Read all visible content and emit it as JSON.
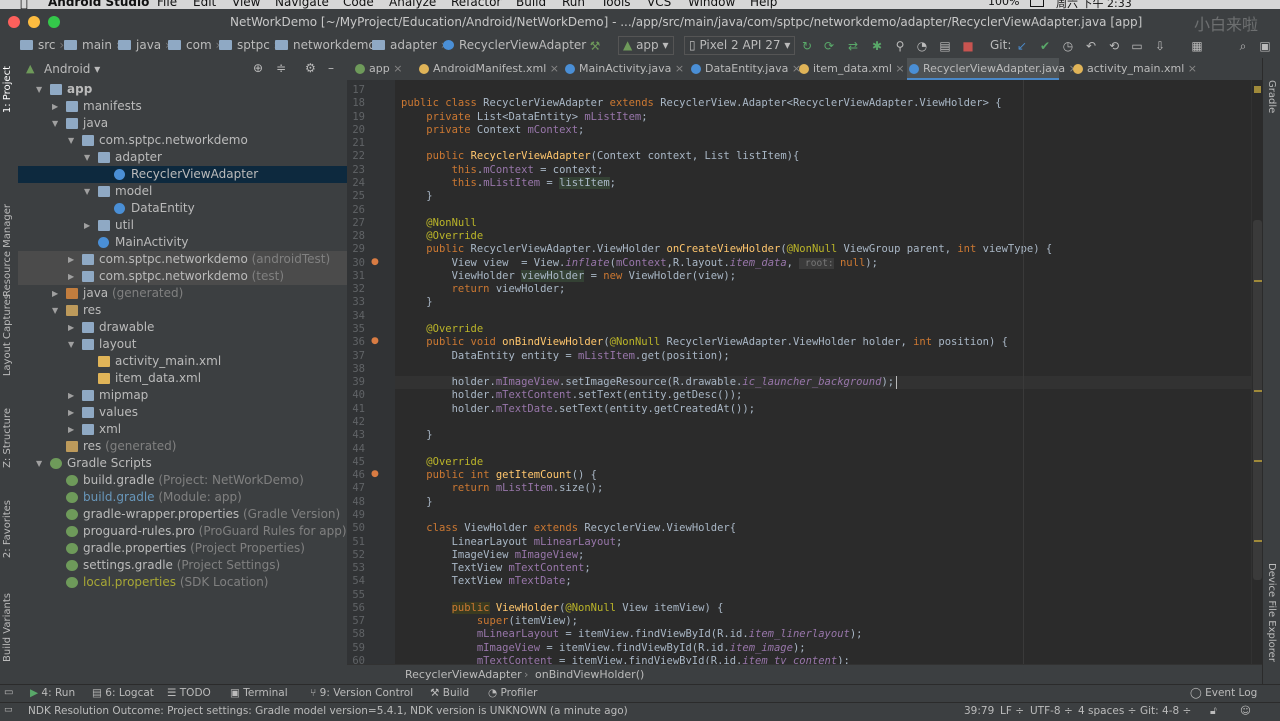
{
  "menubar": {
    "app_name": "Android Studio",
    "items": [
      "File",
      "Edit",
      "View",
      "Navigate",
      "Code",
      "Analyze",
      "Refactor",
      "Build",
      "Run",
      "Tools",
      "VCS",
      "Window",
      "Help"
    ],
    "battery": "100%",
    "clock": "周六 下午 2:33"
  },
  "window": {
    "title": "NetWorkDemo [~/MyProject/Education/Android/NetWorkDemo] - .../app/src/main/java/com/sptpc/networkdemo/adapter/RecyclerViewAdapter.java [app]",
    "watermark": "小白来啦"
  },
  "navbar": {
    "crumbs": [
      "src",
      "main",
      "java",
      "com",
      "sptpc",
      "networkdemo",
      "adapter",
      "RecyclerViewAdapter"
    ],
    "run_config": "app",
    "device": "Pixel 2 API 27",
    "git_label": "Git:"
  },
  "left_tabs": [
    "1: Project",
    "Resource Manager",
    "Layout Captures",
    "Z: Structure",
    "2: Favorites",
    "Build Variants"
  ],
  "right_tabs": [
    "Gradle",
    "Device File Explorer"
  ],
  "project_panel": {
    "view_mode": "Android",
    "tree": [
      {
        "label": "app",
        "hint": "",
        "depth": 0,
        "arrow": "down",
        "icon": "folder",
        "style": "bold"
      },
      {
        "label": "manifests",
        "hint": "",
        "depth": 1,
        "arrow": "right",
        "icon": "folder"
      },
      {
        "label": "java",
        "hint": "",
        "depth": 1,
        "arrow": "down",
        "icon": "folder"
      },
      {
        "label": "com.sptpc.networkdemo",
        "hint": "",
        "depth": 2,
        "arrow": "down",
        "icon": "pkg"
      },
      {
        "label": "adapter",
        "hint": "",
        "depth": 3,
        "arrow": "down",
        "icon": "pkg"
      },
      {
        "label": "RecyclerViewAdapter",
        "hint": "",
        "depth": 4,
        "arrow": "",
        "icon": "class",
        "selected": true
      },
      {
        "label": "model",
        "hint": "",
        "depth": 3,
        "arrow": "down",
        "icon": "pkg"
      },
      {
        "label": "DataEntity",
        "hint": "",
        "depth": 4,
        "arrow": "",
        "icon": "class"
      },
      {
        "label": "util",
        "hint": "",
        "depth": 3,
        "arrow": "right",
        "icon": "pkg"
      },
      {
        "label": "MainActivity",
        "hint": "",
        "depth": 3,
        "arrow": "",
        "icon": "class"
      },
      {
        "label": "com.sptpc.networkdemo",
        "hint": " (androidTest)",
        "depth": 2,
        "arrow": "right",
        "icon": "pkg",
        "shaded": true
      },
      {
        "label": "com.sptpc.networkdemo",
        "hint": " (test)",
        "depth": 2,
        "arrow": "right",
        "icon": "pkg",
        "shaded": true
      },
      {
        "label": "java",
        "hint": " (generated)",
        "depth": 1,
        "arrow": "right",
        "icon": "java"
      },
      {
        "label": "res",
        "hint": "",
        "depth": 1,
        "arrow": "down",
        "icon": "res"
      },
      {
        "label": "drawable",
        "hint": "",
        "depth": 2,
        "arrow": "right",
        "icon": "folder"
      },
      {
        "label": "layout",
        "hint": "",
        "depth": 2,
        "arrow": "down",
        "icon": "folder"
      },
      {
        "label": "activity_main.xml",
        "hint": "",
        "depth": 3,
        "arrow": "",
        "icon": "xml"
      },
      {
        "label": "item_data.xml",
        "hint": "",
        "depth": 3,
        "arrow": "",
        "icon": "xml"
      },
      {
        "label": "mipmap",
        "hint": "",
        "depth": 2,
        "arrow": "right",
        "icon": "folder"
      },
      {
        "label": "values",
        "hint": "",
        "depth": 2,
        "arrow": "right",
        "icon": "folder"
      },
      {
        "label": "xml",
        "hint": "",
        "depth": 2,
        "arrow": "right",
        "icon": "folder"
      },
      {
        "label": "res",
        "hint": " (generated)",
        "depth": 1,
        "arrow": "",
        "icon": "res"
      },
      {
        "label": "Gradle Scripts",
        "hint": "",
        "depth": 0,
        "arrow": "down",
        "icon": "gradle"
      },
      {
        "label": "build.gradle",
        "hint": " (Project: NetWorkDemo)",
        "depth": 1,
        "arrow": "",
        "icon": "gradle"
      },
      {
        "label": "build.gradle",
        "hint": " (Module: app)",
        "depth": 1,
        "arrow": "",
        "icon": "gradle",
        "color": "#6897bb"
      },
      {
        "label": "gradle-wrapper.properties",
        "hint": " (Gradle Version)",
        "depth": 1,
        "arrow": "",
        "icon": "gradle"
      },
      {
        "label": "proguard-rules.pro",
        "hint": " (ProGuard Rules for app)",
        "depth": 1,
        "arrow": "",
        "icon": "gradle"
      },
      {
        "label": "gradle.properties",
        "hint": " (Project Properties)",
        "depth": 1,
        "arrow": "",
        "icon": "gradle"
      },
      {
        "label": "settings.gradle",
        "hint": " (Project Settings)",
        "depth": 1,
        "arrow": "",
        "icon": "gradle"
      },
      {
        "label": "local.properties",
        "hint": " (SDK Location)",
        "depth": 1,
        "arrow": "",
        "icon": "gradle",
        "color": "#a8a836"
      }
    ]
  },
  "editor_tabs": [
    {
      "label": "app",
      "icon_color": "#6e9a5a"
    },
    {
      "label": "AndroidManifest.xml",
      "icon_color": "#e0b458"
    },
    {
      "label": "MainActivity.java",
      "icon_color": "#4a8fd6"
    },
    {
      "label": "DataEntity.java",
      "icon_color": "#4a8fd6"
    },
    {
      "label": "item_data.xml",
      "icon_color": "#e0b458"
    },
    {
      "label": "RecyclerViewAdapter.java",
      "icon_color": "#4a8fd6",
      "active": true
    },
    {
      "label": "activity_main.xml",
      "icon_color": "#e0b458"
    }
  ],
  "line_numbers": [
    17,
    18,
    19,
    20,
    21,
    22,
    23,
    24,
    25,
    26,
    27,
    28,
    29,
    30,
    31,
    32,
    33,
    34,
    35,
    36,
    37,
    38,
    39,
    40,
    41,
    42,
    43,
    44,
    45,
    46,
    47,
    48,
    49,
    50,
    51,
    52,
    53,
    54,
    55,
    56,
    57,
    58,
    59,
    60
  ],
  "code_lines": [
    "",
    "<span class=\"kw\">public class</span> RecyclerViewAdapter <span class=\"kw\">extends</span> RecyclerView.Adapter&lt;RecyclerViewAdapter.ViewHolder&gt; {",
    "    <span class=\"kw\">private</span> List&lt;DataEntity&gt; <span class=\"fld\">mListItem</span>;",
    "    <span class=\"kw\">private</span> Context <span class=\"fld\">mContext</span>;",
    "",
    "    <span class=\"kw\">public</span> <span class=\"fn\">RecyclerViewAdapter</span>(Context context, List listItem){",
    "        <span class=\"kw\">this</span>.<span class=\"fld\">mContext</span> = context;",
    "        <span class=\"kw\">this</span>.<span class=\"fld\">mListItem</span> = <span class=\"hl\">listItem</span>;",
    "    }",
    "",
    "    <span class=\"ann\">@NonNull</span>",
    "    <span class=\"ann\">@Override</span>",
    "    <span class=\"kw\">public</span> RecyclerViewAdapter.ViewHolder <span class=\"fn\">onCreateViewHolder</span>(<span class=\"ann\">@NonNull</span> ViewGroup parent, <span class=\"kw\">int</span> viewType) {",
    "        View view  = View.<span class=\"it\">inflate</span>(<span class=\"fld\">mContext</span>,R.layout.<span class=\"it\">item_data</span>, <span class=\"hint2\"> root:</span> <span class=\"kw\">null</span>);",
    "        ViewHolder <span class=\"hl\">viewHolder</span> = <span class=\"kw\">new</span> ViewHolder(view);",
    "        <span class=\"kw\">return</span> viewHolder;",
    "    }",
    "",
    "    <span class=\"ann\">@Override</span>",
    "    <span class=\"kw\">public void</span> <span class=\"fn\">onBindViewHolder</span>(<span class=\"ann\">@NonNull</span> RecyclerViewAdapter.ViewHolder holder, <span class=\"kw\">int</span> position) {",
    "        DataEntity entity = <span class=\"fld\">mListItem</span>.get(position);",
    "",
    "        holder.<span class=\"fld\">mImageView</span>.setImageResource(R.drawable.<span class=\"it\">ic_launcher_background</span>);",
    "        holder.<span class=\"fld\">mTextContent</span>.setText(entity.getDesc());",
    "        holder.<span class=\"fld\">mTextDate</span>.setText(entity.getCreatedAt());",
    "",
    "    }",
    "",
    "    <span class=\"ann\">@Override</span>",
    "    <span class=\"kw\">public int</span> <span class=\"fn\">getItemCount</span>() {",
    "        <span class=\"kw\">return</span> <span class=\"fld\">mListItem</span>.size();",
    "    }",
    "",
    "    <span class=\"kw\">class</span> ViewHolder <span class=\"kw\">extends</span> RecyclerView.ViewHolder{",
    "        LinearLayout <span class=\"fld\">mLinearLayout</span>;",
    "        ImageView <span class=\"fld\">mImageView</span>;",
    "        TextView <span class=\"fld\">mTextContent</span>;",
    "        TextView <span class=\"fld\">mTextDate</span>;",
    "",
    "        <span class=\"kw\" style=\"background:#3b3b20\">public</span> <span class=\"fn\">ViewHolder</span>(<span class=\"ann\">@NonNull</span> View itemView) {",
    "            <span class=\"kw\">super</span>(itemView);",
    "            <span class=\"fld\">mLinearLayout</span> = itemView.findViewById(R.id.<span class=\"it\">item_linerlayout</span>);",
    "            <span class=\"fld\">mImageView</span> = itemView.findViewById(R.id.<span class=\"it\">item_image</span>);",
    "            <span class=\"fld\">mTextContent</span> = itemView.findViewById(R.id.<span class=\"it\">item_tv_content</span>);"
  ],
  "editor_breadcrumb": [
    "RecyclerViewAdapter",
    "onBindViewHolder()"
  ],
  "bottom_tools": [
    "4: Run",
    "6: Logcat",
    "TODO",
    "Terminal",
    "9: Version Control",
    "Build",
    "Profiler"
  ],
  "event_log": "Event Log",
  "status": {
    "message": "NDK Resolution Outcome: Project settings: Gradle model version=5.4.1, NDK version is UNKNOWN (a minute ago)",
    "position": "39:79",
    "line_sep": "LF ÷",
    "encoding": "UTF-8 ÷",
    "indent": "4 spaces ÷",
    "git": "Git: 4-8 ÷"
  }
}
